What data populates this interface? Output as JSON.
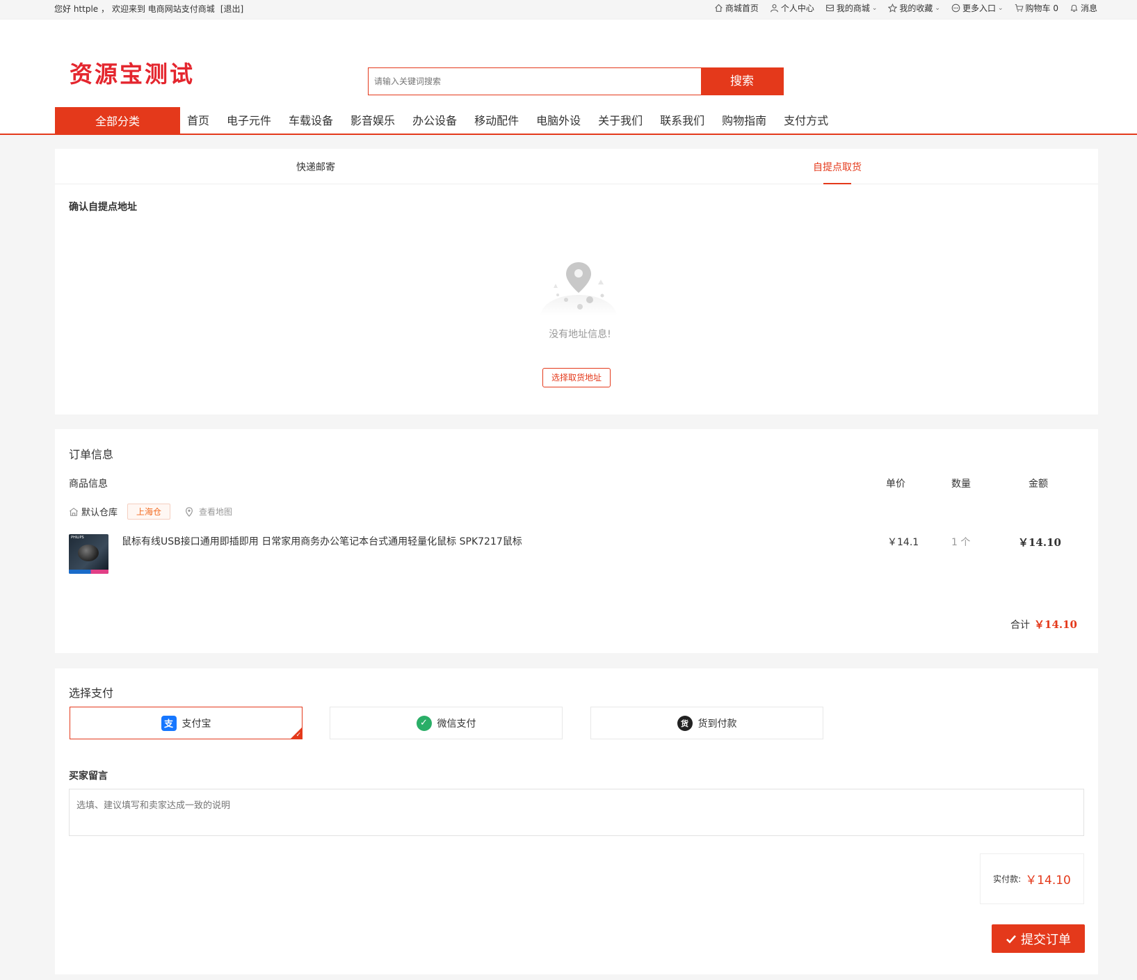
{
  "topbar": {
    "greeting": "您好 httple ，",
    "welcome": "欢迎来到 电商网站支付商城",
    "logout": "[退出]",
    "links": [
      "商城首页",
      "个人中心",
      "我的商城",
      "我的收藏",
      "更多入口",
      "购物车 0",
      "消息"
    ]
  },
  "header": {
    "logo": "资源宝测试",
    "search_placeholder": "请输入关键词搜索",
    "search_button": "搜索"
  },
  "nav": {
    "all_categories": "全部分类",
    "items": [
      "首页",
      "电子元件",
      "车载设备",
      "影音娱乐",
      "办公设备",
      "移动配件",
      "电脑外设",
      "关于我们",
      "联系我们",
      "购物指南",
      "支付方式"
    ]
  },
  "delivery": {
    "tabs": [
      "快递邮寄",
      "自提点取货"
    ],
    "active_tab": 1,
    "section_title": "确认自提点地址",
    "empty_text": "没有地址信息!",
    "pick_button": "选择取货地址"
  },
  "order": {
    "title": "订单信息",
    "col_product": "商品信息",
    "col_price": "单价",
    "col_qty": "数量",
    "col_amount": "金额",
    "warehouse": "默认仓库",
    "warehouse_tag": "上海仓",
    "view_map": "查看地图",
    "product_name": "鼠标有线USB接口通用即插即用 日常家用商务办公笔记本台式通用轻量化鼠标 SPK7217鼠标",
    "thumb_brand": "PHILIPS",
    "price": "￥14.1",
    "qty": "1 个",
    "amount": "￥14.10",
    "total_label": "合计",
    "total_value": "￥14.10"
  },
  "payment": {
    "title": "选择支付",
    "options": [
      "支付宝",
      "微信支付",
      "货到付款"
    ],
    "selected": 0,
    "message_title": "买家留言",
    "message_placeholder": "选填、建议填写和卖家达成一致的说明",
    "paid_label": "实付款:",
    "paid_value": "￥14.10",
    "submit": "提交订单"
  },
  "colors": {
    "accent": "#e4391b",
    "alipay": "#1677ff",
    "wechat": "#2aae67",
    "cod": "#222222"
  }
}
